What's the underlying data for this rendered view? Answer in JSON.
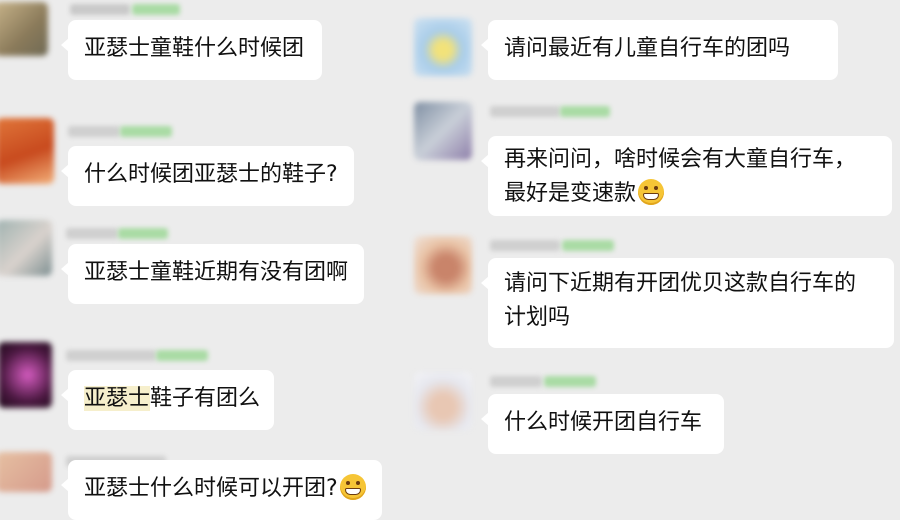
{
  "left_column": {
    "messages": [
      {
        "text": "亚瑟士童鞋什么时候团"
      },
      {
        "text": "什么时候团亚瑟士的鞋子?"
      },
      {
        "text": "亚瑟士童鞋近期有没有团啊"
      },
      {
        "highlight": "亚瑟士",
        "text_rest": "鞋子有团么"
      },
      {
        "text": "亚瑟士什么时候可以开团?",
        "emoji": "grinning-face-emoji"
      }
    ]
  },
  "right_column": {
    "messages": [
      {
        "text": "请问最近有儿童自行车的团吗"
      },
      {
        "line1": "再来问问，啥时候会有大童自行车，",
        "line2": "最好是变速款",
        "emoji": "grinning-face-emoji"
      },
      {
        "line1": "请问下近期有开团优贝这款自行车的",
        "line2": "计划吗"
      },
      {
        "text": "什么时候开团自行车"
      }
    ]
  },
  "colors": {
    "background": "#ececec",
    "bubble": "#ffffff",
    "highlight": "#f6efcc",
    "sender_tag_green": "#9fd49a"
  }
}
